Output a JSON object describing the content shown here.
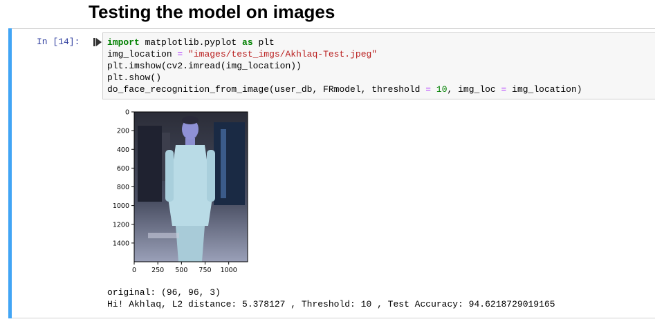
{
  "heading": "Testing the model on images",
  "cell": {
    "prompt": "In [14]:",
    "code_lines": [
      [
        {
          "t": "import",
          "c": "kw"
        },
        {
          "t": " matplotlib.pyplot "
        },
        {
          "t": "as",
          "c": "kw"
        },
        {
          "t": " plt"
        }
      ],
      [
        {
          "t": "img_location "
        },
        {
          "t": "=",
          "c": "op"
        },
        {
          "t": " "
        },
        {
          "t": "\"images/test_imgs/Akhlaq-Test.jpeg\"",
          "c": "st"
        }
      ],
      [
        {
          "t": "plt.imshow(cv2.imread(img_location))"
        }
      ],
      [
        {
          "t": "plt.show()"
        }
      ],
      [
        {
          "t": "do_face_recognition_from_image(user_db, FRmodel, threshold "
        },
        {
          "t": "=",
          "c": "op"
        },
        {
          "t": " "
        },
        {
          "t": "10",
          "c": "nm"
        },
        {
          "t": ", img_loc "
        },
        {
          "t": "=",
          "c": "op"
        },
        {
          "t": " img_location)"
        }
      ]
    ],
    "output_lines": [
      "original: (96, 96, 3)",
      "Hi! Akhlaq, L2 distance: 5.378127 , Threshold: 10 , Test Accuracy: 94.6218729019165"
    ]
  },
  "chart_data": {
    "type": "image",
    "title": "",
    "xlabel": "",
    "ylabel": "",
    "xticks": [
      0,
      250,
      500,
      750,
      1000
    ],
    "yticks": [
      0,
      200,
      400,
      600,
      800,
      1000,
      1200,
      1400
    ],
    "xlim": [
      0,
      1200
    ],
    "ylim": [
      1600,
      0
    ]
  }
}
